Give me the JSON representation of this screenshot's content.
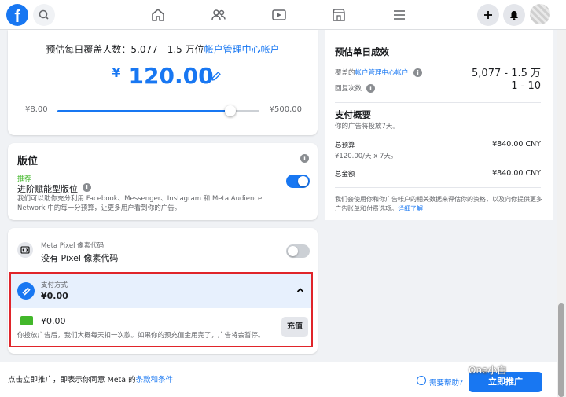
{
  "budget": {
    "reach_prefix": "预估每日覆盖人数：5,077 - 1.5 万位",
    "reach_link": "帐户管理中心帐户",
    "currency_symbol": "¥",
    "amount": "120.00",
    "slider_min": "¥8.00",
    "slider_max": "¥500.00",
    "slider_fraction": 0.855
  },
  "placement": {
    "title": "版位",
    "recommended": "推荐",
    "advantage_label": "进阶赋能型版位",
    "description": "我们可以助你充分利用 Facebook、Messenger、Instagram 和 Meta Audience Network 中的每一分预算，让更多用户看到你的广告。",
    "toggle_on": true
  },
  "pixel": {
    "small_label": "Meta Pixel 像素代码",
    "main_label": "没有 Pixel 像素代码",
    "toggle_on": false
  },
  "payment": {
    "small_label": "支付方式",
    "amount": "¥0.00",
    "card_amount": "¥0.00",
    "note": "你投放广告后，我们大概每天扣一次款。如果你的预充值金用完了，广告将会暂停。",
    "topup_label": "充值"
  },
  "summary": {
    "title": "预估单日成效",
    "covered_prefix": "覆盖的",
    "covered_link": "帐户管理中心帐户",
    "covered_value": "5,077 - 1.5 万",
    "frequency_label": "回复次数",
    "frequency_value": "1 - 10",
    "pay_title": "支付概要",
    "pay_subtitle": "你的广告将投放7天。",
    "total_budget_label": "总预算",
    "total_budget_value": "¥840.00 CNY",
    "total_budget_detail": "¥120.00/天 x 7天。",
    "total_amount_label": "总金额",
    "total_amount_value": "¥840.00 CNY",
    "disclaimer": "我们会使用你和你广告帐户的相关数据来评估你的资格，以及向你提供更多广告账单和付费选项。",
    "learn_more": "详细了解"
  },
  "footer": {
    "terms_prefix": "点击立即推广，即表示你同意 Meta 的",
    "terms_link": "条款和条件",
    "help": "需要帮助?",
    "promote": "立即推广"
  },
  "watermark": "One小白",
  "colors": {
    "accent": "#1877f2",
    "highlight_border": "#e0242a",
    "success": "#42b72a"
  },
  "icons": [
    "facebook-logo",
    "search-icon",
    "home-icon",
    "friends-icon",
    "video-icon",
    "marketplace-icon",
    "menu-icon",
    "plus-icon",
    "bell-icon",
    "pencil-icon",
    "info-icon",
    "code-icon",
    "payment-icon",
    "chevron-up-icon",
    "card-icon",
    "help-icon"
  ]
}
